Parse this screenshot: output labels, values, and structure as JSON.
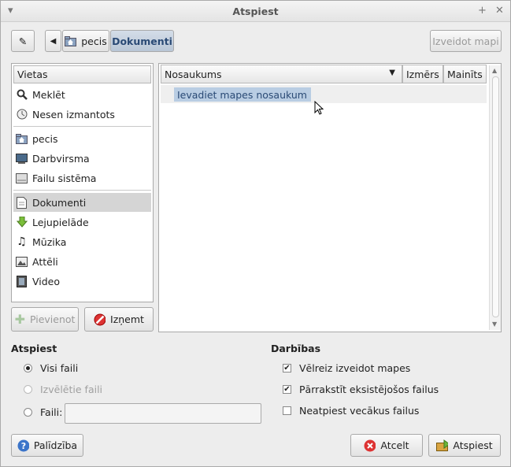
{
  "window": {
    "title": "Atspiest"
  },
  "toolbar": {
    "path": [
      "pecis",
      "Dokumenti"
    ],
    "create_folder_label": "Izveidot mapi"
  },
  "sidebar": {
    "header": "Vietas",
    "items": [
      {
        "label": "Meklēt",
        "icon": "search-icon"
      },
      {
        "label": "Nesen izmantots",
        "icon": "recent-icon"
      },
      {
        "label": "pecis",
        "icon": "home-folder-icon"
      },
      {
        "label": "Darbvirsma",
        "icon": "desktop-icon"
      },
      {
        "label": "Failu sistēma",
        "icon": "drive-icon"
      },
      {
        "label": "Dokumenti",
        "icon": "document-icon"
      },
      {
        "label": "Lejupielāde",
        "icon": "download-icon"
      },
      {
        "label": "Mūzika",
        "icon": "music-icon"
      },
      {
        "label": "Attēli",
        "icon": "pictures-icon"
      },
      {
        "label": "Video",
        "icon": "video-icon"
      }
    ],
    "add_label": "Pievienot",
    "remove_label": "Izņemt"
  },
  "filelist": {
    "columns": [
      "Nosaukums",
      "Izmērs",
      "Mainīts"
    ],
    "new_folder_input": "Ievadiet mapes nosaukumu"
  },
  "atspiest": {
    "heading": "Atspiest",
    "options": [
      "Visi faili",
      "Izvēlētie faili",
      "Faili:"
    ],
    "selected": "Visi faili",
    "files_value": ""
  },
  "darbibas": {
    "heading": "Darbības",
    "options": [
      {
        "label": "Vēlreiz izveidot mapes",
        "checked": true
      },
      {
        "label": "Pārrakstīt eksistējošos failus",
        "checked": true
      },
      {
        "label": "Neatpiest vecākus failus",
        "checked": false
      }
    ]
  },
  "buttons": {
    "help": "Palīdzība",
    "cancel": "Atcelt",
    "extract": "Atspiest"
  }
}
